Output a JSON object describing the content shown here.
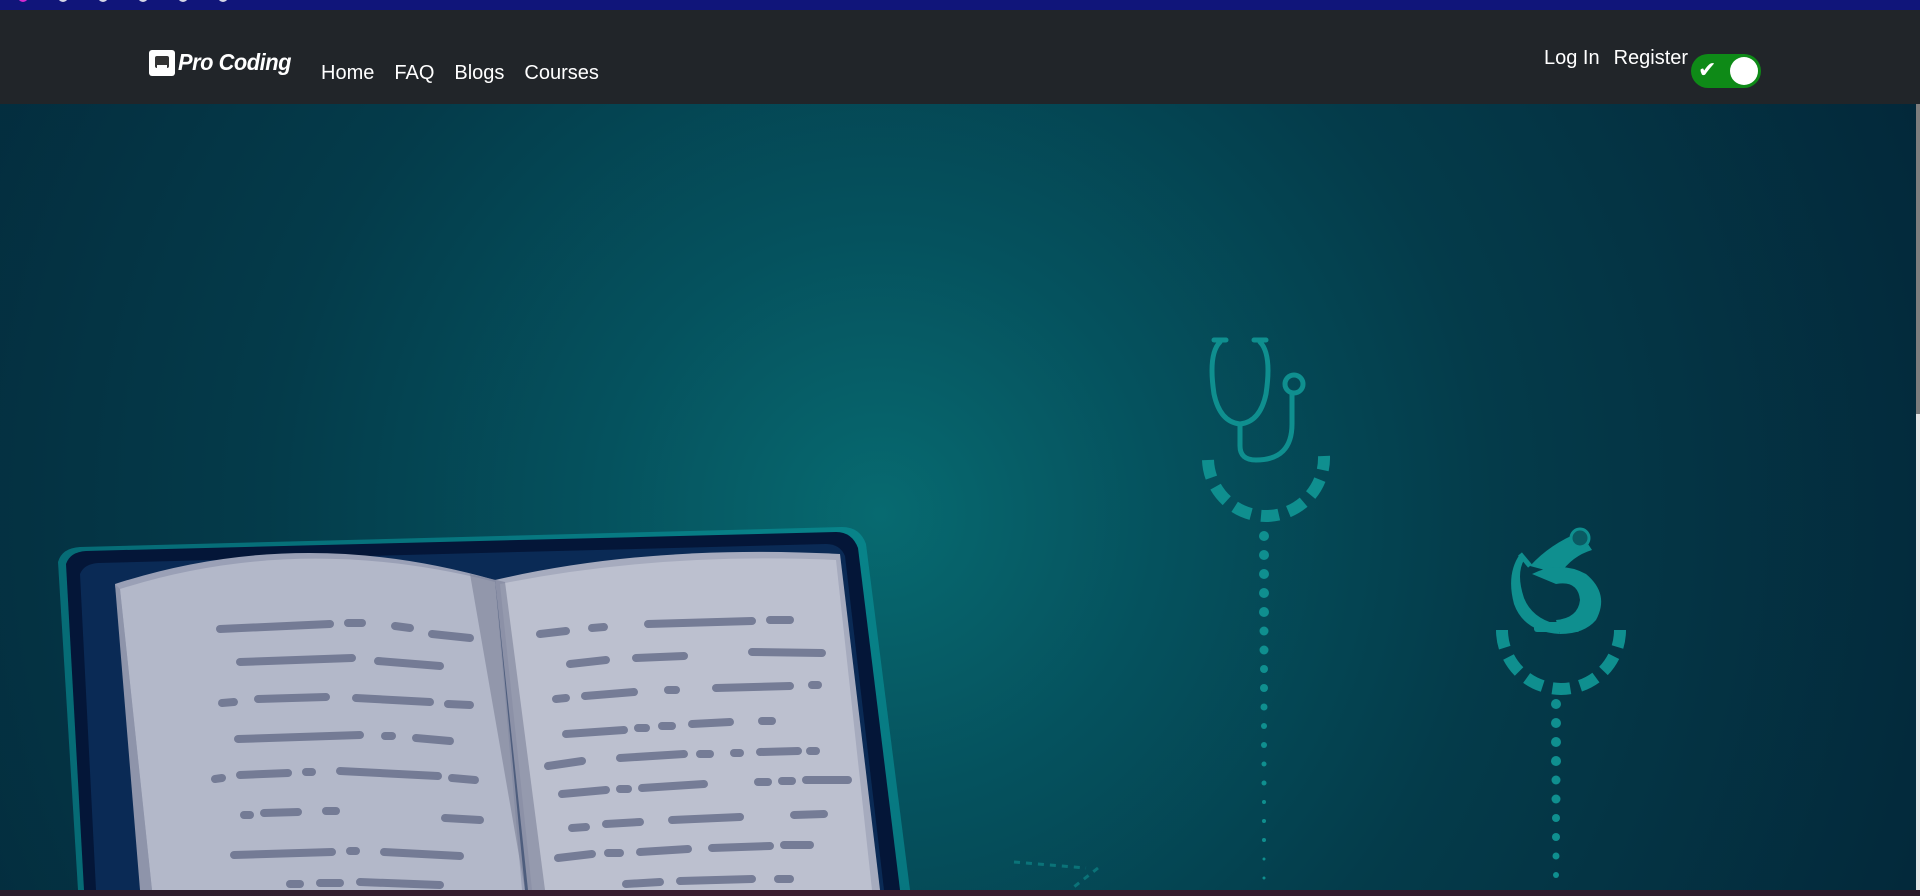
{
  "brand": {
    "name": "Pro Coding"
  },
  "nav": {
    "links": [
      {
        "label": "Home"
      },
      {
        "label": "FAQ"
      },
      {
        "label": "Blogs"
      },
      {
        "label": "Courses"
      }
    ]
  },
  "auth": {
    "login_label": "Log In",
    "register_label": "Register"
  },
  "theme_toggle": {
    "state": "on",
    "color": "#0e8a17"
  },
  "hero": {
    "illustrations": [
      "open-book-icon",
      "tablet-icon",
      "stethoscope-icon",
      "microscope-icon"
    ],
    "accent_color": "#0f8f8f"
  }
}
